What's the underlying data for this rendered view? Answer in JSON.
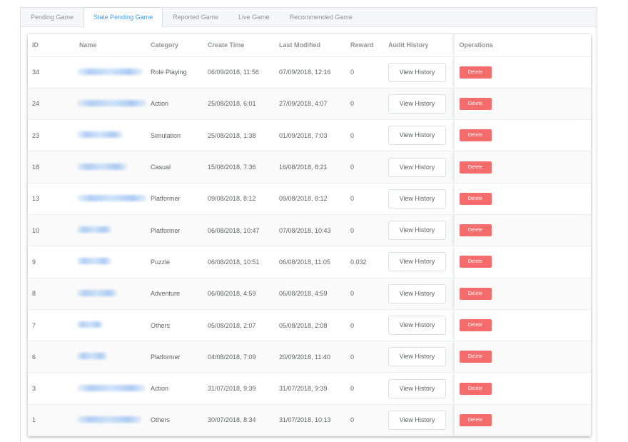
{
  "tabs": [
    {
      "label": "Pending Game",
      "active": false
    },
    {
      "label": "Stale Pending Game",
      "active": true
    },
    {
      "label": "Reported Game",
      "active": false
    },
    {
      "label": "Live Game",
      "active": false
    },
    {
      "label": "Recommended Game",
      "active": false
    }
  ],
  "columns": {
    "id": "ID",
    "name": "Name",
    "category": "Category",
    "create_time": "Create Time",
    "last_modified": "Last Modified",
    "reward": "Reward",
    "audit_history": "Audit History",
    "operations": "Operations"
  },
  "buttons": {
    "view_history": "View History",
    "delete": "Delete"
  },
  "rows": [
    {
      "id": "34",
      "category": "Role Playing",
      "create_time": "06/09/2018, 11:56",
      "last_modified": "07/09/2018, 12:16",
      "reward": "0"
    },
    {
      "id": "24",
      "category": "Action",
      "create_time": "25/08/2018, 6:01",
      "last_modified": "27/09/2018, 4:07",
      "reward": "0"
    },
    {
      "id": "23",
      "category": "Simulation",
      "create_time": "25/08/2018, 1:38",
      "last_modified": "01/09/2018, 7:03",
      "reward": "0"
    },
    {
      "id": "18",
      "category": "Casual",
      "create_time": "15/08/2018, 7:36",
      "last_modified": "16/08/2018, 8:21",
      "reward": "0"
    },
    {
      "id": "13",
      "category": "Platformer",
      "create_time": "09/08/2018, 8:12",
      "last_modified": "09/08/2018, 8:12",
      "reward": "0"
    },
    {
      "id": "10",
      "category": "Platformer",
      "create_time": "06/08/2018, 10:47",
      "last_modified": "07/08/2018, 10:43",
      "reward": "0"
    },
    {
      "id": "9",
      "category": "Puzzle",
      "create_time": "06/08/2018, 10:51",
      "last_modified": "06/08/2018, 11:05",
      "reward": "0.032"
    },
    {
      "id": "8",
      "category": "Adventure",
      "create_time": "06/08/2018, 4:59",
      "last_modified": "06/08/2018, 4:59",
      "reward": "0"
    },
    {
      "id": "7",
      "category": "Others",
      "create_time": "05/08/2018, 2:07",
      "last_modified": "05/08/2018, 2:08",
      "reward": "0"
    },
    {
      "id": "6",
      "category": "Platformer",
      "create_time": "04/08/2018, 7:09",
      "last_modified": "20/09/2018, 11:40",
      "reward": "0"
    },
    {
      "id": "3",
      "category": "Action",
      "create_time": "31/07/2018, 9:39",
      "last_modified": "31/07/2018, 9:39",
      "reward": "0"
    },
    {
      "id": "1",
      "category": "Others",
      "create_time": "30/07/2018, 8:34",
      "last_modified": "31/07/2018, 10:13",
      "reward": "0"
    }
  ],
  "colors": {
    "accent": "#409eff",
    "danger": "#f56c6c"
  }
}
